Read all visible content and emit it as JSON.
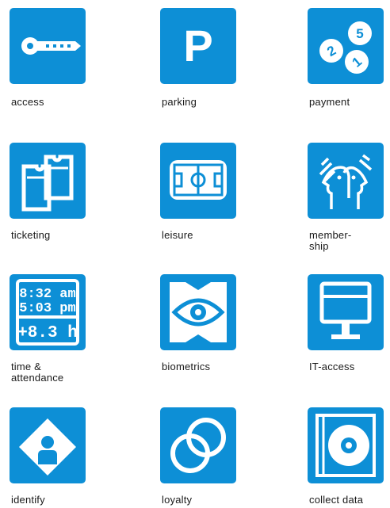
{
  "colors": {
    "tile": "#0d8fd6",
    "icon": "#ffffff",
    "text": "#1a1a1a"
  },
  "items": [
    {
      "icon": "key-icon",
      "label": "access"
    },
    {
      "icon": "parking-icon",
      "label": "parking",
      "glyph": "P"
    },
    {
      "icon": "coins-icon",
      "label": "payment",
      "coin_numbers": [
        "2",
        "5",
        "1"
      ]
    },
    {
      "icon": "tickets-icon",
      "label": "ticketing"
    },
    {
      "icon": "soccer-field-icon",
      "label": "leisure"
    },
    {
      "icon": "people-faces-icon",
      "label": "member-\nship"
    },
    {
      "icon": "clock-display-icon",
      "label": "time &\nattendance",
      "times": [
        "8:32 am",
        "5:03 pm"
      ],
      "duration": "+8.3 h"
    },
    {
      "icon": "eye-icon",
      "label": "biometrics"
    },
    {
      "icon": "computer-terminal-icon",
      "label": "IT-access"
    },
    {
      "icon": "person-diamond-icon",
      "label": "identify"
    },
    {
      "icon": "interlocking-rings-icon",
      "label": "loyalty"
    },
    {
      "icon": "cd-disc-icon",
      "label": "collect data"
    }
  ]
}
